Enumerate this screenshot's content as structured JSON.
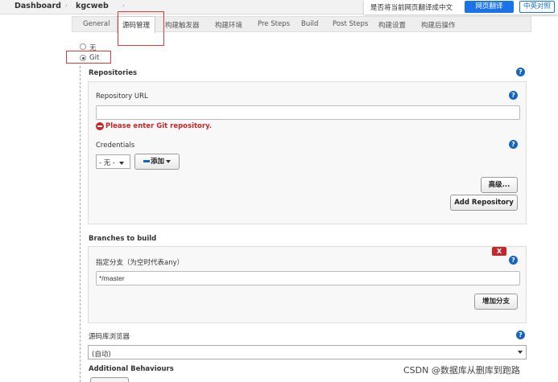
{
  "breadcrumb": {
    "items": [
      "Dashboard",
      "kgcweb"
    ],
    "separator": "›"
  },
  "translate_bar": {
    "prompt": "是否将当前网页翻译成中文",
    "translate_button": "网页翻译",
    "compare_button": "中英对照"
  },
  "tabs": [
    "General",
    "源码管理",
    "构建触发器",
    "构建环境",
    "Pre Steps",
    "Build",
    "Post Steps",
    "构建设置",
    "构建后操作"
  ],
  "active_tab": "源码管理",
  "scm": {
    "options": [
      "无",
      "Git"
    ],
    "selected": "Git"
  },
  "repositories": {
    "section_label": "Repositories",
    "url_label": "Repository URL",
    "url_value": "",
    "error": "Please enter Git repository.",
    "credentials_label": "Credentials",
    "credentials_selected": "- 无 -",
    "add_button": "添加",
    "advanced_button": "高级...",
    "add_repo_button": "Add Repository"
  },
  "branches": {
    "section_label": "Branches to build",
    "delete_button": "X",
    "spec_label": "指定分支（为空时代表any）",
    "spec_value": "*/master",
    "add_branch_button": "增加分支"
  },
  "browser": {
    "label": "源码库浏览器",
    "selected": "(自动)"
  },
  "behaviours": {
    "label": "Additional Behaviours"
  },
  "help_icon_text": "?",
  "watermark": "CSDN @数据库从删库到跑路",
  "colors": {
    "accent_blue": "#1565c0",
    "error_red": "#c62828",
    "highlight_red": "#e53935",
    "translate_blue": "#1a73e8"
  }
}
